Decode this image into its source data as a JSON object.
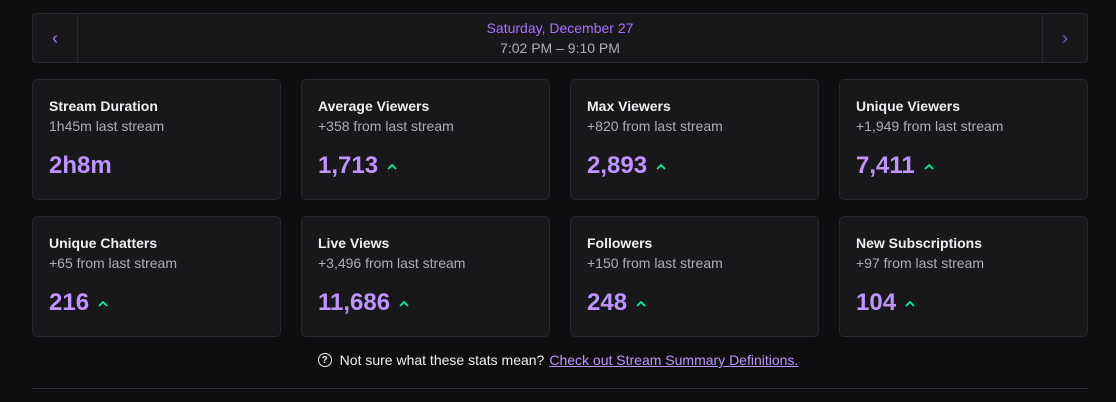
{
  "nav": {
    "prev_icon": "‹",
    "next_icon": "›",
    "date": "Saturday, December 27",
    "time": "7:02 PM – 9:10 PM"
  },
  "stats": [
    {
      "title": "Stream Duration",
      "sub": "1h45m last stream",
      "value": "2h8m",
      "trend": "none"
    },
    {
      "title": "Average Viewers",
      "sub": "+358 from last stream",
      "value": "1,713",
      "trend": "up"
    },
    {
      "title": "Max Viewers",
      "sub": "+820 from last stream",
      "value": "2,893",
      "trend": "up"
    },
    {
      "title": "Unique Viewers",
      "sub": "+1,949 from last stream",
      "value": "7,411",
      "trend": "up"
    },
    {
      "title": "Unique Chatters",
      "sub": "+65 from last stream",
      "value": "216",
      "trend": "up"
    },
    {
      "title": "Live Views",
      "sub": "+3,496 from last stream",
      "value": "11,686",
      "trend": "up"
    },
    {
      "title": "Followers",
      "sub": "+150 from last stream",
      "value": "248",
      "trend": "up"
    },
    {
      "title": "New Subscriptions",
      "sub": "+97 from last stream",
      "value": "104",
      "trend": "up"
    }
  ],
  "help": {
    "icon": "?",
    "text": "Not sure what these stats mean?",
    "link": "Check out Stream Summary Definitions."
  },
  "colors": {
    "accent": "#bf94ff",
    "trend_up": "#00f593",
    "background": "#0e0e10",
    "card": "#18181b"
  }
}
